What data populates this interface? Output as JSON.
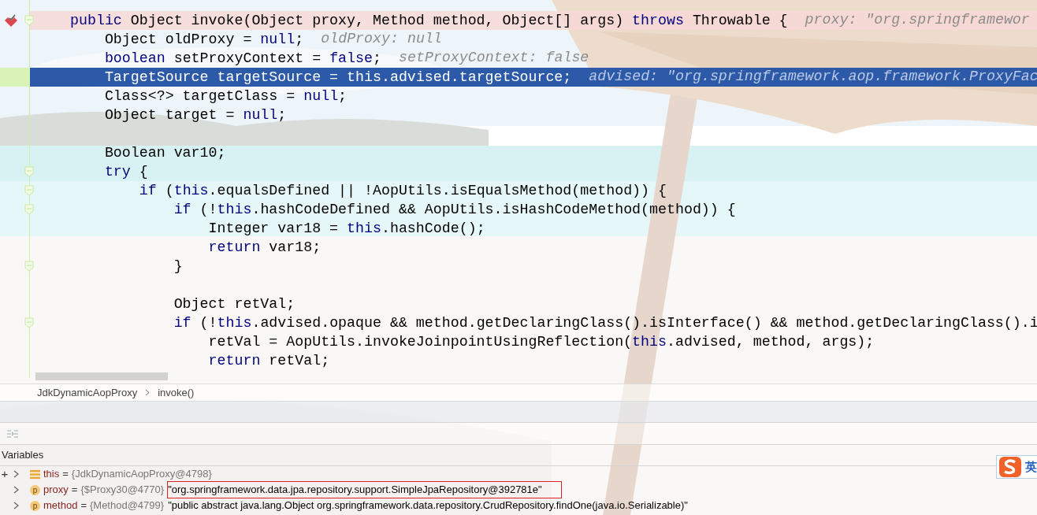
{
  "editor": {
    "lines": [
      {
        "breakpoint": true,
        "current": false,
        "fold": true,
        "tokens": [
          {
            "kind": "keyword",
            "text": "public"
          },
          {
            "kind": "plain",
            "text": " Object invoke(Object proxy, Method method, Object[] args) "
          },
          {
            "kind": "keyword",
            "text": "throws"
          },
          {
            "kind": "plain",
            "text": " Throwable {"
          }
        ],
        "hint": "proxy: \"org.springframewor"
      },
      {
        "breakpoint": false,
        "current": false,
        "fold": false,
        "tokens": [
          {
            "kind": "plain",
            "text": "    Object oldProxy = "
          },
          {
            "kind": "keyword",
            "text": "null"
          },
          {
            "kind": "plain",
            "text": ";"
          }
        ],
        "hint": "oldProxy: null"
      },
      {
        "breakpoint": false,
        "current": false,
        "fold": false,
        "tokens": [
          {
            "kind": "keyword",
            "text": "    boolean"
          },
          {
            "kind": "plain",
            "text": " setProxyContext = "
          },
          {
            "kind": "keyword",
            "text": "false"
          },
          {
            "kind": "plain",
            "text": ";"
          }
        ],
        "hint": "setProxyContext: false"
      },
      {
        "breakpoint": false,
        "current": true,
        "fold": false,
        "tokens": [
          {
            "kind": "plain",
            "text": "    TargetSource targetSource = "
          },
          {
            "kind": "keyword",
            "text": "this"
          },
          {
            "kind": "plain",
            "text": ".advised.targetSource;"
          }
        ],
        "hint": "advised: \"org.springframework.aop.framework.ProxyFac"
      },
      {
        "breakpoint": false,
        "current": false,
        "fold": false,
        "tokens": [
          {
            "kind": "plain",
            "text": "    Class<?> targetClass = "
          },
          {
            "kind": "keyword",
            "text": "null"
          },
          {
            "kind": "plain",
            "text": ";"
          }
        ]
      },
      {
        "breakpoint": false,
        "current": false,
        "fold": false,
        "tokens": [
          {
            "kind": "plain",
            "text": "    Object target = "
          },
          {
            "kind": "keyword",
            "text": "null"
          },
          {
            "kind": "plain",
            "text": ";"
          }
        ]
      },
      {
        "breakpoint": false,
        "current": false,
        "fold": false
      },
      {
        "breakpoint": false,
        "current": false,
        "fold": false,
        "tokens": [
          {
            "kind": "plain",
            "text": "    Boolean var10;"
          }
        ]
      },
      {
        "breakpoint": false,
        "current": false,
        "fold": true,
        "tokens": [
          {
            "kind": "keyword",
            "text": "    try"
          },
          {
            "kind": "plain",
            "text": " {"
          }
        ]
      },
      {
        "breakpoint": false,
        "current": false,
        "fold": true,
        "tokens": [
          {
            "kind": "keyword",
            "text": "        if"
          },
          {
            "kind": "plain",
            "text": " ("
          },
          {
            "kind": "keyword",
            "text": "this"
          },
          {
            "kind": "plain",
            "text": ".equalsDefined || !AopUtils.isEqualsMethod(method)) {"
          }
        ]
      },
      {
        "breakpoint": false,
        "current": false,
        "fold": true,
        "tokens": [
          {
            "kind": "keyword",
            "text": "            if"
          },
          {
            "kind": "plain",
            "text": " (!"
          },
          {
            "kind": "keyword",
            "text": "this"
          },
          {
            "kind": "plain",
            "text": ".hashCodeDefined && AopUtils.isHashCodeMethod(method)) {"
          }
        ]
      },
      {
        "breakpoint": false,
        "current": false,
        "fold": false,
        "tokens": [
          {
            "kind": "plain",
            "text": "                Integer var18 = "
          },
          {
            "kind": "keyword",
            "text": "this"
          },
          {
            "kind": "plain",
            "text": ".hashCode();"
          }
        ]
      },
      {
        "breakpoint": false,
        "current": false,
        "fold": false,
        "tokens": [
          {
            "kind": "keyword",
            "text": "                return"
          },
          {
            "kind": "plain",
            "text": " var18;"
          }
        ]
      },
      {
        "breakpoint": false,
        "current": false,
        "fold": true,
        "tokens": [
          {
            "kind": "plain",
            "text": "            }"
          }
        ]
      },
      {
        "breakpoint": false,
        "current": false,
        "fold": false
      },
      {
        "breakpoint": false,
        "current": false,
        "fold": false,
        "tokens": [
          {
            "kind": "plain",
            "text": "            Object retVal;"
          }
        ]
      },
      {
        "breakpoint": false,
        "current": false,
        "fold": true,
        "tokens": [
          {
            "kind": "keyword",
            "text": "            if"
          },
          {
            "kind": "plain",
            "text": " (!"
          },
          {
            "kind": "keyword",
            "text": "this"
          },
          {
            "kind": "plain",
            "text": ".advised.opaque && method.getDeclaringClass().isInterface() && method.getDeclaringClass().i"
          }
        ]
      },
      {
        "breakpoint": false,
        "current": false,
        "fold": false,
        "tokens": [
          {
            "kind": "plain",
            "text": "                retVal = AopUtils.invokeJoinpointUsingReflection("
          },
          {
            "kind": "keyword",
            "text": "this"
          },
          {
            "kind": "plain",
            "text": ".advised, method, args);"
          }
        ]
      },
      {
        "breakpoint": false,
        "current": false,
        "fold": false,
        "tokens": [
          {
            "kind": "keyword",
            "text": "                return"
          },
          {
            "kind": "plain",
            "text": " retVal;"
          }
        ]
      }
    ]
  },
  "breadcrumbs": [
    "JdkDynamicAopProxy",
    "invoke()"
  ],
  "variables_panel": {
    "title": "Variables",
    "add_button": "+",
    "variables": [
      {
        "kind": "object",
        "name": "this",
        "equals": "=",
        "ref": "{JdkDynamicAopProxy@4798}",
        "outlined": false
      },
      {
        "kind": "parameter",
        "badge": "p",
        "name": "proxy",
        "equals": "=",
        "ref": "{$Proxy30@4770}",
        "value": "\"org.springframework.data.jpa.repository.support.SimpleJpaRepository@392781e\"",
        "outlined": true
      },
      {
        "kind": "parameter",
        "badge": "p",
        "name": "method",
        "equals": "=",
        "ref": "{Method@4799}",
        "value": "\"public abstract java.lang.Object org.springframework.data.repository.CrudRepository.findOne(java.io.Serializable)\"",
        "outlined": false
      }
    ]
  },
  "ime_indicator": {
    "mode": "英"
  }
}
